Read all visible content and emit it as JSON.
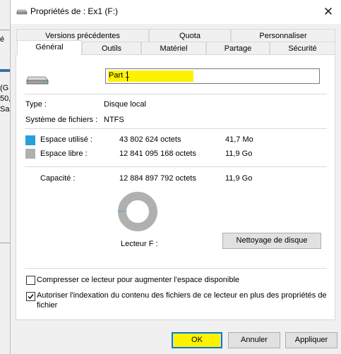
{
  "background_window": {
    "fragments": [
      "é",
      "(G",
      "50,",
      "Sai"
    ]
  },
  "dialog": {
    "title": "Propriétés de : Ex1 (F:)"
  },
  "tabs": {
    "row1": [
      "Versions précédentes",
      "Quota",
      "Personnaliser"
    ],
    "row2": [
      "Général",
      "Outils",
      "Matériel",
      "Partage",
      "Sécurité"
    ],
    "selected": "Général"
  },
  "general": {
    "drive_name": "Part 1",
    "type_label": "Type :",
    "type_value": "Disque local",
    "fs_label": "Système de fichiers :",
    "fs_value": "NTFS",
    "used": {
      "label": "Espace utilisé :",
      "bytes": "43 802 624 octets",
      "size": "41,7 Mo",
      "color": "#26a0da"
    },
    "free": {
      "label": "Espace libre :",
      "bytes": "12 841 095 168 octets",
      "size": "11,9 Go",
      "color": "#b0b0b0"
    },
    "capacity": {
      "label": "Capacité :",
      "bytes": "12 884 897 792 octets",
      "size": "11,9 Go"
    },
    "drive_label": "Lecteur F :",
    "cleanup_button": "Nettoyage de disque",
    "used_fraction": 0.0034
  },
  "options": {
    "compress": {
      "label": "Compresser ce lecteur pour augmenter l'espace disponible",
      "checked": false
    },
    "index": {
      "label_line1": "Autoriser l'indexation du contenu des fichiers de ce lecteur en plus des propriétés de",
      "label_line2": "fichier",
      "checked": true
    }
  },
  "buttons": {
    "ok": "OK",
    "cancel": "Annuler",
    "apply": "Appliquer"
  },
  "colors": {
    "highlight": "#fff200",
    "accent": "#0078d7"
  }
}
